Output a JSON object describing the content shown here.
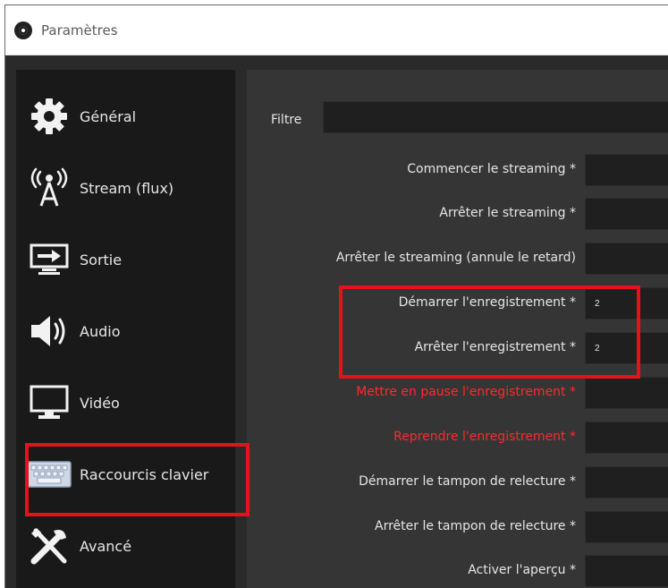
{
  "window": {
    "title": "Paramètres"
  },
  "sidebar": {
    "items": [
      {
        "label": "Général",
        "icon": "gear-icon"
      },
      {
        "label": "Stream (flux)",
        "icon": "antenna-icon"
      },
      {
        "label": "Sortie",
        "icon": "output-icon"
      },
      {
        "label": "Audio",
        "icon": "speaker-icon"
      },
      {
        "label": "Vidéo",
        "icon": "monitor-icon"
      },
      {
        "label": "Raccourcis clavier",
        "icon": "keyboard-icon"
      },
      {
        "label": "Avancé",
        "icon": "tools-icon"
      }
    ]
  },
  "main": {
    "filter_label": "Filtre",
    "filter_value": "",
    "rows": [
      {
        "label": "Commencer le streaming *",
        "value": ""
      },
      {
        "label": "Arrêter le streaming *",
        "value": ""
      },
      {
        "label": "Arrêter le streaming (annule le retard)",
        "value": ""
      },
      {
        "label": "Démarrer l'enregistrement *",
        "value": "2"
      },
      {
        "label": "Arrêter l'enregistrement *",
        "value": "2"
      },
      {
        "label": "Mettre en pause l'enregistrement *",
        "value": ""
      },
      {
        "label": "Reprendre l'enregistrement *",
        "value": ""
      },
      {
        "label": "Démarrer le tampon de relecture *",
        "value": ""
      },
      {
        "label": "Arrêter le tampon de relecture *",
        "value": ""
      },
      {
        "label": "Activer l'aperçu *",
        "value": ""
      }
    ]
  },
  "colors": {
    "highlight": "#e8101b",
    "warning_text": "#ff2a2a",
    "sidebar_bg": "#191919",
    "panel_bg": "#353535"
  }
}
